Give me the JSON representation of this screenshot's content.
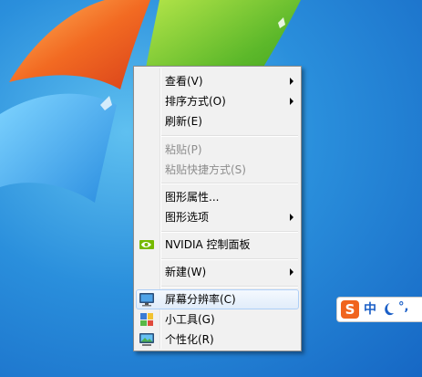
{
  "context_menu": {
    "items": [
      {
        "label": "查看(V)",
        "submenu": true,
        "disabled": false
      },
      {
        "label": "排序方式(O)",
        "submenu": true,
        "disabled": false
      },
      {
        "label": "刷新(E)",
        "submenu": false,
        "disabled": false
      },
      {
        "label": "粘贴(P)",
        "submenu": false,
        "disabled": true
      },
      {
        "label": "粘贴快捷方式(S)",
        "submenu": false,
        "disabled": true
      },
      {
        "label": "图形属性...",
        "submenu": false,
        "disabled": false
      },
      {
        "label": "图形选项",
        "submenu": true,
        "disabled": false
      },
      {
        "label": "NVIDIA 控制面板",
        "submenu": false,
        "disabled": false,
        "icon": "nvidia-icon"
      },
      {
        "label": "新建(W)",
        "submenu": true,
        "disabled": false
      },
      {
        "label": "屏幕分辨率(C)",
        "submenu": false,
        "disabled": false,
        "highlighted": true,
        "icon": "monitor-icon"
      },
      {
        "label": "小工具(G)",
        "submenu": false,
        "disabled": false,
        "icon": "gadgets-icon"
      },
      {
        "label": "个性化(R)",
        "submenu": false,
        "disabled": false,
        "icon": "personalize-icon"
      }
    ]
  },
  "ime_toolbar": {
    "logo": "S",
    "mode": "中",
    "moon": "half-width-moon-icon",
    "punct": "°,"
  },
  "colors": {
    "desktop_blue": "#1e7fd6",
    "menu_bg": "#f1f1f1",
    "highlight_border": "#aecff7",
    "sogou_orange": "#f0641e"
  }
}
